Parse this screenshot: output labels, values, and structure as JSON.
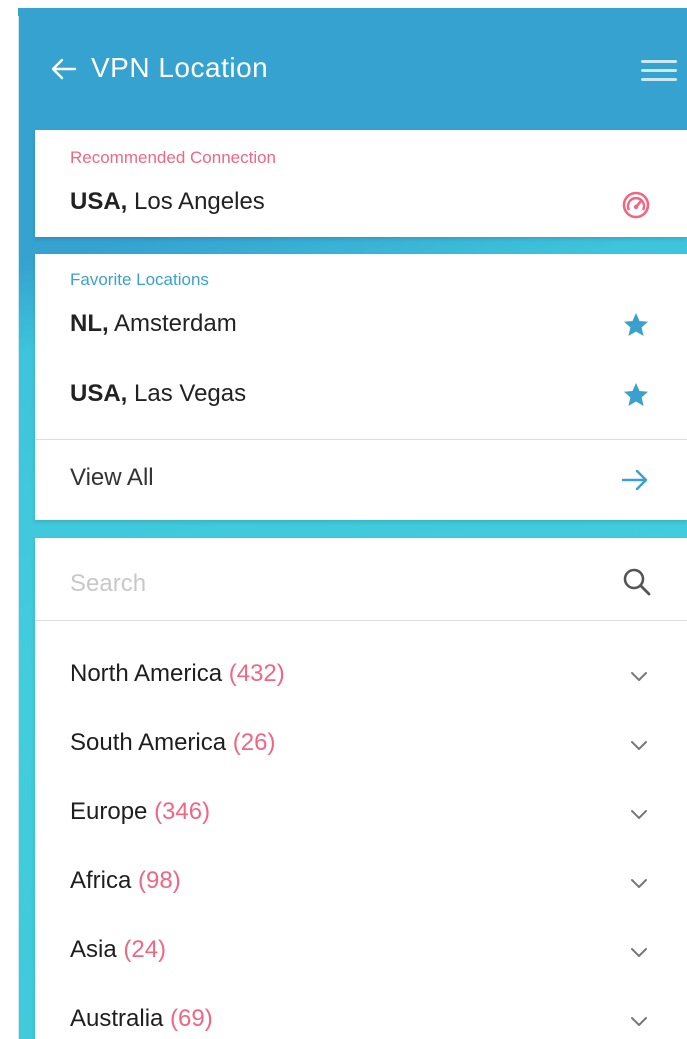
{
  "header": {
    "title": "VPN Location",
    "back_icon": "arrow-left-icon",
    "menu_icon": "hamburger-menu-icon"
  },
  "recommended": {
    "label": "Recommended Connection",
    "country": "USA,",
    "city": "Los Angeles",
    "icon": "speedometer-icon"
  },
  "favorites": {
    "label": "Favorite Locations",
    "items": [
      {
        "country": "NL,",
        "city": "Amsterdam",
        "icon": "star-icon"
      },
      {
        "country": "USA,",
        "city": "Las Vegas",
        "icon": "star-icon"
      }
    ],
    "view_all": "View All"
  },
  "search": {
    "placeholder": "Search"
  },
  "regions": [
    {
      "name": "North America",
      "count": "(432)"
    },
    {
      "name": "South America",
      "count": "(26)"
    },
    {
      "name": "Europe",
      "count": "(346)"
    },
    {
      "name": "Africa",
      "count": "(98)"
    },
    {
      "name": "Asia",
      "count": "(24)"
    },
    {
      "name": "Australia",
      "count": "(69)"
    }
  ],
  "colors": {
    "header_blue": "#35a2d0",
    "teal_background": "#42cddc",
    "accent_pink": "#f06683",
    "star_blue": "#3aa1cf"
  }
}
